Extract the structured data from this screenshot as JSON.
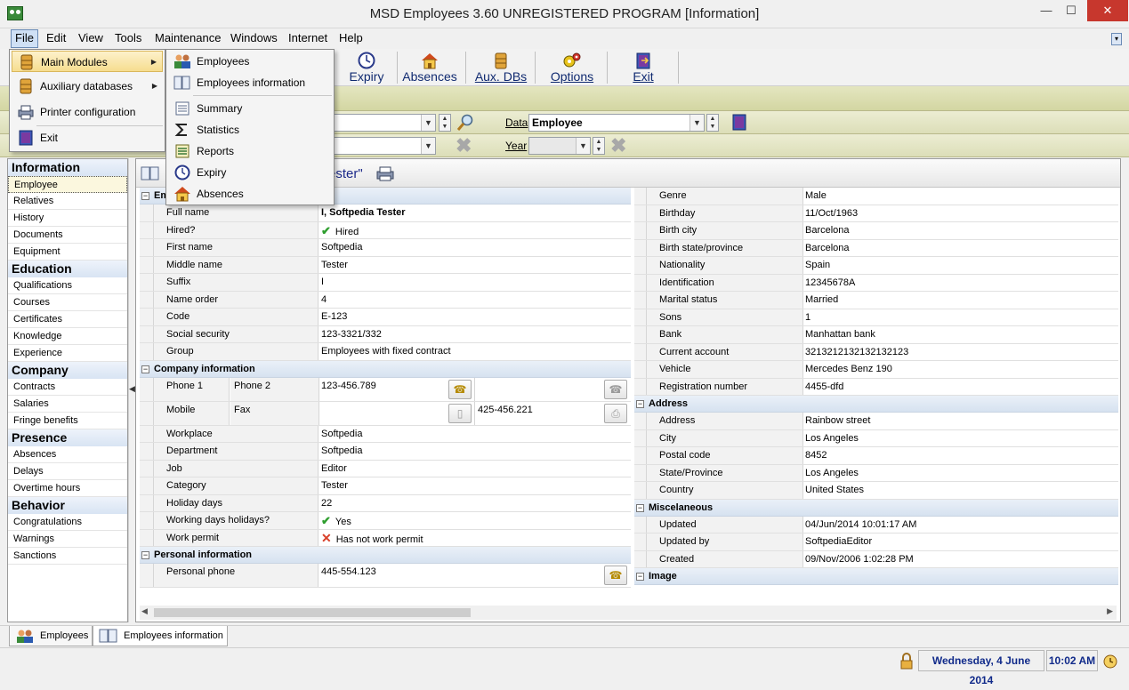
{
  "window": {
    "title": "MSD Employees 3.60 UNREGISTERED PROGRAM [Information]",
    "minimize": "—",
    "maximize": "☐",
    "close": "✕"
  },
  "menu": [
    "File",
    "Edit",
    "View",
    "Tools",
    "Maintenance",
    "Windows",
    "Internet",
    "Help"
  ],
  "toolbar": {
    "buttons": [
      "Expiry",
      "Absences",
      "Aux. DBs",
      "Options",
      "Exit"
    ]
  },
  "file_menu": {
    "items": [
      "Main Modules",
      "Auxiliary databases",
      "Printer configuration",
      "Exit"
    ]
  },
  "submenu": {
    "items": [
      "Employees",
      "Employees information",
      "Summary",
      "Statistics",
      "Reports",
      "Expiry",
      "Absences"
    ]
  },
  "filters": {
    "data_label": "Data",
    "data_value": "Employee",
    "year_label": "Year",
    "year_value": ""
  },
  "content_title": "ester\"",
  "left_panel": {
    "groups": [
      {
        "title": "Information",
        "items": [
          "Employee",
          "Relatives",
          "History",
          "Documents",
          "Equipment"
        ]
      },
      {
        "title": "Education",
        "items": [
          "Qualifications",
          "Courses",
          "Certificates",
          "Knowledge",
          "Experience"
        ]
      },
      {
        "title": "Company",
        "items": [
          "Contracts",
          "Salaries",
          "Fringe benefits"
        ]
      },
      {
        "title": "Presence",
        "items": [
          "Absences",
          "Delays",
          "Overtime hours"
        ]
      },
      {
        "title": "Behavior",
        "items": [
          "Congratulations",
          "Warnings",
          "Sanctions"
        ]
      }
    ],
    "selected": "Employee"
  },
  "employee": {
    "section_partial": "Em",
    "full_name_label": "Full name",
    "full_name": "I, Softpedia Tester",
    "hired_label": "Hired?",
    "hired": "Hired",
    "first_name_label": "First name",
    "first_name": "Softpedia",
    "middle_name_label": "Middle name",
    "middle_name": "Tester",
    "suffix_label": "Suffix",
    "suffix": "I",
    "name_order_label": "Name order",
    "name_order": "4",
    "code_label": "Code",
    "code": "E-123",
    "social_label": "Social security",
    "social": "123-3321/332",
    "group_label": "Group",
    "group": "Employees with fixed contract"
  },
  "company": {
    "section": "Company information",
    "phone1_label": "Phone 1",
    "phone2_label": "Phone 2",
    "phone1": "123-456.789",
    "phone2": "",
    "mobile_label": "Mobile",
    "fax_label": "Fax",
    "mobile": "",
    "fax": "425-456.221",
    "workplace_label": "Workplace",
    "workplace": "Softpedia",
    "department_label": "Department",
    "department": "Softpedia",
    "job_label": "Job",
    "job": "Editor",
    "category_label": "Category",
    "category": "Tester",
    "holiday_label": "Holiday days",
    "holiday": "22",
    "wdh_label": "Working days holidays?",
    "wdh": "Yes",
    "permit_label": "Work permit",
    "permit": "Has not work permit"
  },
  "personal": {
    "section": "Personal information",
    "phone_label": "Personal phone",
    "phone": "445-554.123"
  },
  "details": {
    "genre_label": "Genre",
    "genre": "Male",
    "birthday_label": "Birthday",
    "birthday": "11/Oct/1963",
    "birth_city_label": "Birth city",
    "birth_city": "Barcelona",
    "birth_state_label": "Birth state/province",
    "birth_state": "Barcelona",
    "nationality_label": "Nationality",
    "nationality": "Spain",
    "identification_label": "Identification",
    "identification": "12345678A",
    "marital_label": "Marital status",
    "marital": "Married",
    "sons_label": "Sons",
    "sons": "1",
    "bank_label": "Bank",
    "bank": "Manhattan bank",
    "account_label": "Current account",
    "account": "3213212132132132123",
    "vehicle_label": "Vehicle",
    "vehicle": "Mercedes Benz 190",
    "registration_label": "Registration number",
    "registration": "4455-dfd"
  },
  "address": {
    "section": "Address",
    "address_label": "Address",
    "address": "Rainbow street",
    "city_label": "City",
    "city": "Los Angeles",
    "postal_label": "Postal code",
    "postal": "8452",
    "state_label": "State/Province",
    "state": "Los Angeles",
    "country_label": "Country",
    "country": "United States"
  },
  "misc": {
    "section": "Miscelaneous",
    "updated_label": "Updated",
    "updated": "04/Jun/2014 10:01:17 AM",
    "updated_by_label": "Updated by",
    "updated_by": "SoftpediaEditor",
    "created_label": "Created",
    "created": "09/Nov/2006 1:02:28 PM"
  },
  "image_section": "Image",
  "bottom_tabs": [
    "Employees",
    "Employees information"
  ],
  "status": {
    "date": "Wednesday, 4 June 2014",
    "time": "10:02 AM"
  },
  "colors": {
    "toolbar_label": "#102a70",
    "highlight": "#f6dd8f",
    "section_header": "#d6e2f0"
  }
}
